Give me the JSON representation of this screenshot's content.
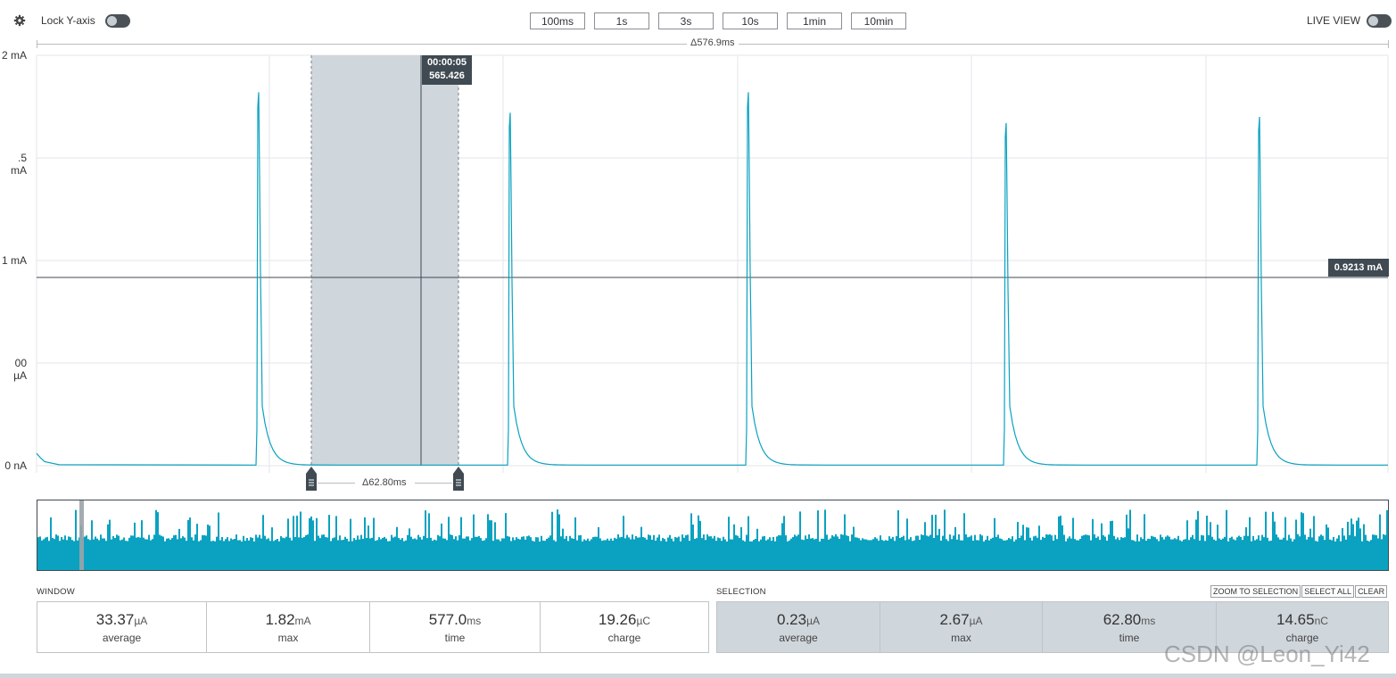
{
  "toolbar": {
    "lock_y_label": "Lock Y-axis",
    "time_buttons": [
      "100ms",
      "1s",
      "3s",
      "10s",
      "1min",
      "10min"
    ],
    "live_view_label": "LIVE VIEW"
  },
  "chart": {
    "window_delta": "Δ576.9ms",
    "y_ticks": [
      "2 mA",
      ".5 mA",
      "1 mA",
      "00 µA",
      "0 nA"
    ],
    "cursor_time": "00:00:05",
    "cursor_value": "565.426",
    "hline_label": "0.9213 mA",
    "selection_delta": "Δ62.80ms"
  },
  "chart_data": {
    "type": "line",
    "ylim": [
      0,
      2
    ],
    "x_range_ms": [
      0,
      576.9
    ],
    "spike_peaks_mA": [
      1.82,
      1.72,
      1.82,
      1.67,
      1.7
    ],
    "selection_ms": [
      70,
      132.8
    ],
    "cursor_ms": 125,
    "hline_mA": 0.9213,
    "grid": true
  },
  "window_stats": {
    "title": "WINDOW",
    "items": [
      {
        "value": "33.37",
        "unit": "µA",
        "label": "average"
      },
      {
        "value": "1.82",
        "unit": "mA",
        "label": "max"
      },
      {
        "value": "577.0",
        "unit": "ms",
        "label": "time"
      },
      {
        "value": "19.26",
        "unit": "µC",
        "label": "charge"
      }
    ]
  },
  "selection_stats": {
    "title": "SELECTION",
    "buttons": [
      "ZOOM TO SELECTION",
      "SELECT ALL",
      "CLEAR"
    ],
    "items": [
      {
        "value": "0.23",
        "unit": "µA",
        "label": "average"
      },
      {
        "value": "2.67",
        "unit": "µA",
        "label": "max"
      },
      {
        "value": "62.80",
        "unit": "ms",
        "label": "time"
      },
      {
        "value": "14.65",
        "unit": "nC",
        "label": "charge"
      }
    ]
  },
  "watermark": "CSDN @Leon_Yi42",
  "colors": {
    "trace": "#0aa2c0",
    "selection": "#cfd6dc",
    "dark": "#3f4a52"
  }
}
